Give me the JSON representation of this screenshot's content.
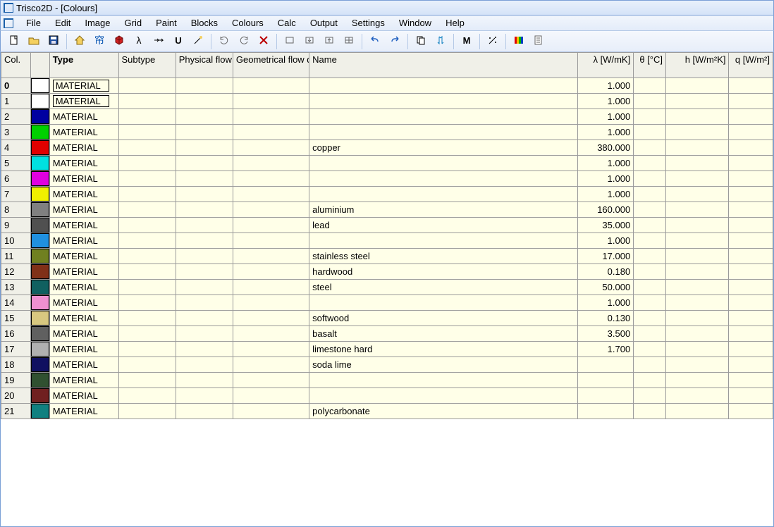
{
  "window": {
    "title": "Trisco2D - [Colours]"
  },
  "menu": {
    "items": [
      "File",
      "Edit",
      "Image",
      "Grid",
      "Paint",
      "Blocks",
      "Colours",
      "Calc",
      "Output",
      "Settings",
      "Window",
      "Help"
    ]
  },
  "toolbar": {
    "buttons": [
      "new-file-icon",
      "open-file-icon",
      "save-icon",
      "sep",
      "home-icon",
      "chinese-char-icon",
      "cube-icon",
      "lambda-icon",
      "arrows-hv-icon",
      "letter-u-icon",
      "wand-sparkle-icon",
      "sep",
      "undo-rotate-icon",
      "redo-rotate-icon",
      "delete-x-icon",
      "sep",
      "rect-empty-icon",
      "rect-down-icon",
      "rect-up-icon",
      "rect-grid-icon",
      "sep",
      "undo-icon",
      "redo-icon",
      "sep",
      "copy-icon",
      "updown-arrows-icon",
      "sep",
      "letter-m-icon",
      "sep",
      "wand-dots-icon",
      "sep",
      "rainbow-icon",
      "document-icon"
    ]
  },
  "columns": {
    "col": "Col.",
    "blank": "",
    "type": "Type",
    "subtype": "Subtype",
    "phys": "Physical flow dir.",
    "geom": "Geometrical flow dir.",
    "name": "Name",
    "lambda": "λ [W/mK]",
    "theta": "θ [°C]",
    "h": "h [W/m²K]",
    "q": "q [W/m²]"
  },
  "rows": [
    {
      "idx": "0",
      "bold": true,
      "color": "#ffffff",
      "type": "MATERIAL",
      "boxed": true,
      "name": "",
      "lambda": "1.000"
    },
    {
      "idx": "1",
      "color": "#ffffff",
      "type": "MATERIAL",
      "boxed": true,
      "name": "",
      "lambda": "1.000"
    },
    {
      "idx": "2",
      "color": "#0000a0",
      "type": "MATERIAL",
      "name": "",
      "lambda": "1.000"
    },
    {
      "idx": "3",
      "color": "#00d000",
      "type": "MATERIAL",
      "name": "",
      "lambda": "1.000"
    },
    {
      "idx": "4",
      "color": "#e00000",
      "type": "MATERIAL",
      "name": "copper",
      "lambda": "380.000"
    },
    {
      "idx": "5",
      "color": "#00e0e0",
      "type": "MATERIAL",
      "name": "",
      "lambda": "1.000"
    },
    {
      "idx": "6",
      "color": "#e000e0",
      "type": "MATERIAL",
      "name": "",
      "lambda": "1.000"
    },
    {
      "idx": "7",
      "color": "#f0f000",
      "type": "MATERIAL",
      "name": "",
      "lambda": "1.000"
    },
    {
      "idx": "8",
      "color": "#808080",
      "type": "MATERIAL",
      "name": "aluminium",
      "lambda": "160.000"
    },
    {
      "idx": "9",
      "color": "#505050",
      "type": "MATERIAL",
      "name": "lead",
      "lambda": "35.000"
    },
    {
      "idx": "10",
      "color": "#2090e0",
      "type": "MATERIAL",
      "name": "",
      "lambda": "1.000"
    },
    {
      "idx": "11",
      "color": "#708020",
      "type": "MATERIAL",
      "name": "stainless steel",
      "lambda": "17.000"
    },
    {
      "idx": "12",
      "color": "#803018",
      "type": "MATERIAL",
      "name": "hardwood",
      "lambda": "0.180"
    },
    {
      "idx": "13",
      "color": "#106060",
      "type": "MATERIAL",
      "name": "steel",
      "lambda": "50.000"
    },
    {
      "idx": "14",
      "color": "#f090d0",
      "type": "MATERIAL",
      "name": "",
      "lambda": "1.000"
    },
    {
      "idx": "15",
      "color": "#d8c880",
      "type": "MATERIAL",
      "name": "softwood",
      "lambda": "0.130"
    },
    {
      "idx": "16",
      "color": "#606060",
      "type": "MATERIAL",
      "name": "basalt",
      "lambda": "3.500"
    },
    {
      "idx": "17",
      "color": "#b0b0b0",
      "type": "MATERIAL",
      "name": "limestone hard",
      "lambda": "1.700"
    },
    {
      "idx": "18",
      "color": "#101060",
      "type": "MATERIAL",
      "name": "soda lime",
      "lambda": ""
    },
    {
      "idx": "19",
      "color": "#305030",
      "type": "MATERIAL",
      "name": "",
      "lambda": ""
    },
    {
      "idx": "20",
      "color": "#702020",
      "type": "MATERIAL",
      "name": "",
      "lambda": ""
    },
    {
      "idx": "21",
      "color": "#108080",
      "type": "MATERIAL",
      "name": "polycarbonate",
      "lambda": ""
    }
  ]
}
